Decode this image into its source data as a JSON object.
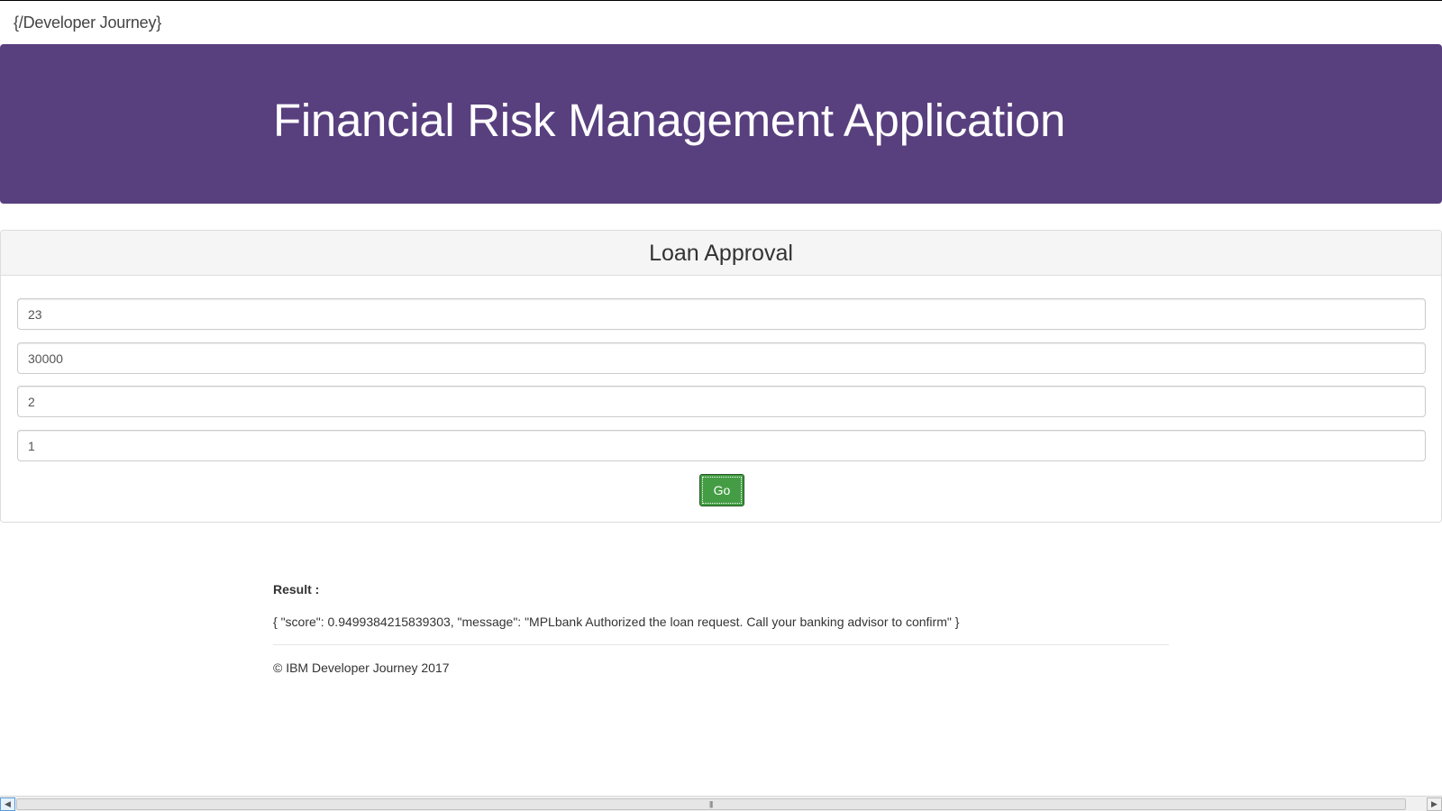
{
  "navbar": {
    "brand": "{/Developer Journey}"
  },
  "jumbotron": {
    "title": "Financial Risk Management Application"
  },
  "panel": {
    "heading": "Loan Approval",
    "fields": [
      {
        "value": "23"
      },
      {
        "value": "30000"
      },
      {
        "value": "2"
      },
      {
        "value": "1"
      }
    ],
    "go_label": "Go"
  },
  "result": {
    "label": "Result :",
    "text": "{ \"score\": 0.9499384215839303, \"message\": \"MPLbank Authorized the loan request. Call your banking advisor to confirm\" }"
  },
  "footer": {
    "text": "© IBM Developer Journey 2017"
  },
  "colors": {
    "jumbotron_bg": "#583f7e",
    "go_button": "#449d44"
  },
  "icons": {
    "scroll_left": "scroll-left-arrow-icon",
    "scroll_right": "scroll-right-arrow-icon"
  }
}
